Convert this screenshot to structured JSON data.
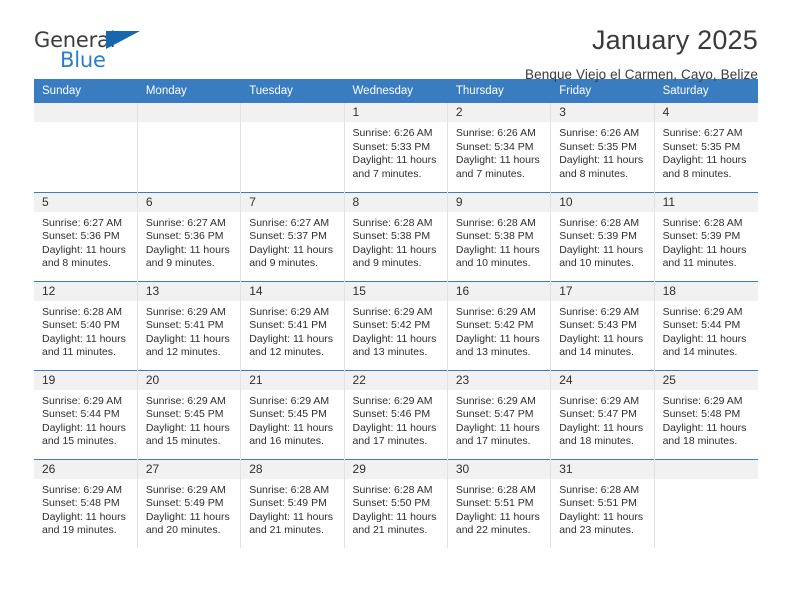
{
  "brand": {
    "name_top": "General",
    "name_bottom": "Blue",
    "accent_color": "#2a7fc9",
    "triangle_color": "#1666b0"
  },
  "header": {
    "title": "January 2025",
    "subtitle": "Benque Viejo el Carmen, Cayo, Belize",
    "header_bg_color": "#3a7cc0",
    "daynum_bg_color": "#f1f1f1"
  },
  "calendar": {
    "weekdays": [
      "Sunday",
      "Monday",
      "Tuesday",
      "Wednesday",
      "Thursday",
      "Friday",
      "Saturday"
    ],
    "weeks": [
      [
        {
          "day": "",
          "empty": true
        },
        {
          "day": "",
          "empty": true
        },
        {
          "day": "",
          "empty": true
        },
        {
          "day": "1",
          "sunrise": "Sunrise: 6:26 AM",
          "sunset": "Sunset: 5:33 PM",
          "daylight": "Daylight: 11 hours and 7 minutes."
        },
        {
          "day": "2",
          "sunrise": "Sunrise: 6:26 AM",
          "sunset": "Sunset: 5:34 PM",
          "daylight": "Daylight: 11 hours and 7 minutes."
        },
        {
          "day": "3",
          "sunrise": "Sunrise: 6:26 AM",
          "sunset": "Sunset: 5:35 PM",
          "daylight": "Daylight: 11 hours and 8 minutes."
        },
        {
          "day": "4",
          "sunrise": "Sunrise: 6:27 AM",
          "sunset": "Sunset: 5:35 PM",
          "daylight": "Daylight: 11 hours and 8 minutes."
        }
      ],
      [
        {
          "day": "5",
          "sunrise": "Sunrise: 6:27 AM",
          "sunset": "Sunset: 5:36 PM",
          "daylight": "Daylight: 11 hours and 8 minutes."
        },
        {
          "day": "6",
          "sunrise": "Sunrise: 6:27 AM",
          "sunset": "Sunset: 5:36 PM",
          "daylight": "Daylight: 11 hours and 9 minutes."
        },
        {
          "day": "7",
          "sunrise": "Sunrise: 6:27 AM",
          "sunset": "Sunset: 5:37 PM",
          "daylight": "Daylight: 11 hours and 9 minutes."
        },
        {
          "day": "8",
          "sunrise": "Sunrise: 6:28 AM",
          "sunset": "Sunset: 5:38 PM",
          "daylight": "Daylight: 11 hours and 9 minutes."
        },
        {
          "day": "9",
          "sunrise": "Sunrise: 6:28 AM",
          "sunset": "Sunset: 5:38 PM",
          "daylight": "Daylight: 11 hours and 10 minutes."
        },
        {
          "day": "10",
          "sunrise": "Sunrise: 6:28 AM",
          "sunset": "Sunset: 5:39 PM",
          "daylight": "Daylight: 11 hours and 10 minutes."
        },
        {
          "day": "11",
          "sunrise": "Sunrise: 6:28 AM",
          "sunset": "Sunset: 5:39 PM",
          "daylight": "Daylight: 11 hours and 11 minutes."
        }
      ],
      [
        {
          "day": "12",
          "sunrise": "Sunrise: 6:28 AM",
          "sunset": "Sunset: 5:40 PM",
          "daylight": "Daylight: 11 hours and 11 minutes."
        },
        {
          "day": "13",
          "sunrise": "Sunrise: 6:29 AM",
          "sunset": "Sunset: 5:41 PM",
          "daylight": "Daylight: 11 hours and 12 minutes."
        },
        {
          "day": "14",
          "sunrise": "Sunrise: 6:29 AM",
          "sunset": "Sunset: 5:41 PM",
          "daylight": "Daylight: 11 hours and 12 minutes."
        },
        {
          "day": "15",
          "sunrise": "Sunrise: 6:29 AM",
          "sunset": "Sunset: 5:42 PM",
          "daylight": "Daylight: 11 hours and 13 minutes."
        },
        {
          "day": "16",
          "sunrise": "Sunrise: 6:29 AM",
          "sunset": "Sunset: 5:42 PM",
          "daylight": "Daylight: 11 hours and 13 minutes."
        },
        {
          "day": "17",
          "sunrise": "Sunrise: 6:29 AM",
          "sunset": "Sunset: 5:43 PM",
          "daylight": "Daylight: 11 hours and 14 minutes."
        },
        {
          "day": "18",
          "sunrise": "Sunrise: 6:29 AM",
          "sunset": "Sunset: 5:44 PM",
          "daylight": "Daylight: 11 hours and 14 minutes."
        }
      ],
      [
        {
          "day": "19",
          "sunrise": "Sunrise: 6:29 AM",
          "sunset": "Sunset: 5:44 PM",
          "daylight": "Daylight: 11 hours and 15 minutes."
        },
        {
          "day": "20",
          "sunrise": "Sunrise: 6:29 AM",
          "sunset": "Sunset: 5:45 PM",
          "daylight": "Daylight: 11 hours and 15 minutes."
        },
        {
          "day": "21",
          "sunrise": "Sunrise: 6:29 AM",
          "sunset": "Sunset: 5:45 PM",
          "daylight": "Daylight: 11 hours and 16 minutes."
        },
        {
          "day": "22",
          "sunrise": "Sunrise: 6:29 AM",
          "sunset": "Sunset: 5:46 PM",
          "daylight": "Daylight: 11 hours and 17 minutes."
        },
        {
          "day": "23",
          "sunrise": "Sunrise: 6:29 AM",
          "sunset": "Sunset: 5:47 PM",
          "daylight": "Daylight: 11 hours and 17 minutes."
        },
        {
          "day": "24",
          "sunrise": "Sunrise: 6:29 AM",
          "sunset": "Sunset: 5:47 PM",
          "daylight": "Daylight: 11 hours and 18 minutes."
        },
        {
          "day": "25",
          "sunrise": "Sunrise: 6:29 AM",
          "sunset": "Sunset: 5:48 PM",
          "daylight": "Daylight: 11 hours and 18 minutes."
        }
      ],
      [
        {
          "day": "26",
          "sunrise": "Sunrise: 6:29 AM",
          "sunset": "Sunset: 5:48 PM",
          "daylight": "Daylight: 11 hours and 19 minutes."
        },
        {
          "day": "27",
          "sunrise": "Sunrise: 6:29 AM",
          "sunset": "Sunset: 5:49 PM",
          "daylight": "Daylight: 11 hours and 20 minutes."
        },
        {
          "day": "28",
          "sunrise": "Sunrise: 6:28 AM",
          "sunset": "Sunset: 5:49 PM",
          "daylight": "Daylight: 11 hours and 21 minutes."
        },
        {
          "day": "29",
          "sunrise": "Sunrise: 6:28 AM",
          "sunset": "Sunset: 5:50 PM",
          "daylight": "Daylight: 11 hours and 21 minutes."
        },
        {
          "day": "30",
          "sunrise": "Sunrise: 6:28 AM",
          "sunset": "Sunset: 5:51 PM",
          "daylight": "Daylight: 11 hours and 22 minutes."
        },
        {
          "day": "31",
          "sunrise": "Sunrise: 6:28 AM",
          "sunset": "Sunset: 5:51 PM",
          "daylight": "Daylight: 11 hours and 23 minutes."
        },
        {
          "day": "",
          "empty": true
        }
      ]
    ]
  }
}
